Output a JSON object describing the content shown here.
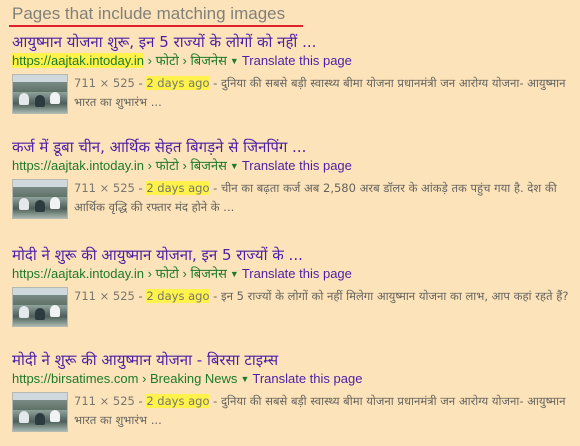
{
  "heading": "Pages that include matching images",
  "results": [
    {
      "title": "आयुष्मान योजना शुरू, इन 5 राज्यों के लोगों को नहीं ...",
      "url": "https://aajtak.intoday.in",
      "crumbs": "› फोटो › बिजनेस",
      "translate": "Translate this page",
      "dims": "711 × 525",
      "date": "2 days ago",
      "snippet": "दुनिया की सबसे बड़ी स्वास्थ्य बीमा योजना प्रधानमंत्री जन आरोग्य योजना- आयुष्मान भारत का शुभारंभ ..."
    },
    {
      "title": "कर्ज में डूबा चीन, आर्थिक सेहत बिगड़ने से जिनपिंग ...",
      "url": "https://aajtak.intoday.in",
      "crumbs": "› फोटो › बिजनेस",
      "translate": "Translate this page",
      "dims": "711 × 525",
      "date": "2 days ago",
      "snippet": "चीन का बढ़ता कर्ज अब 2,580 अरब डॉलर के आंकड़े तक पहुंच गया है. देश की आर्थिक वृद्धि की रफ्तार मंद होने के ..."
    },
    {
      "title": "मोदी ने शुरू की आयुष्मान योजना, इन 5 राज्यों के ...",
      "url": "https://aajtak.intoday.in",
      "crumbs": "› फोटो › बिजनेस",
      "translate": "Translate this page",
      "dims": "711 × 525",
      "date": "2 days ago",
      "snippet": "इन 5 राज्यों के लोगों को नहीं मिलेगा आयुष्मान योजना का लाभ, आप कहां रहते हैं?"
    },
    {
      "title": "मोदी ने शुरू की आयुष्मान योजना - बिरसा टाइम्स",
      "url": "https://birsatimes.com",
      "crumbs": "› Breaking News",
      "translate": "Translate this page",
      "dims": "711 × 525",
      "date": "2 days ago",
      "snippet": "दुनिया की सबसे बड़ी स्वास्थ्य बीमा योजना प्रधानमंत्री जन आरोग्य योजना- आयुष्मान भारत का शुभारंभ ..."
    }
  ],
  "colors": {
    "background": "#fde3b9",
    "title": "#4b1fa6",
    "url": "#1b7a2b",
    "highlight": "#fff24a",
    "underline": "#e0212b"
  }
}
